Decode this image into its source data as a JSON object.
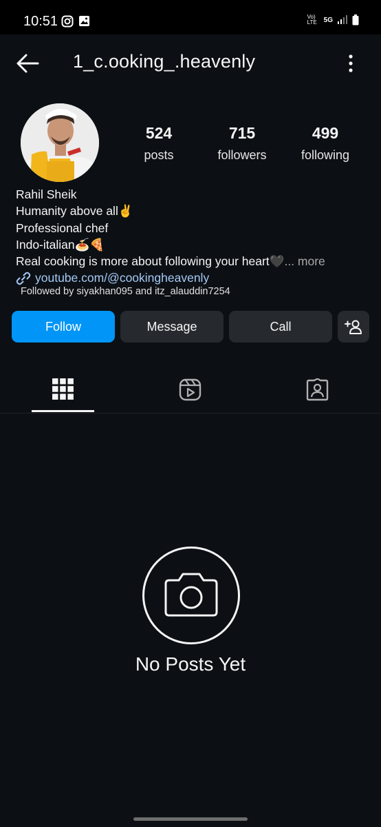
{
  "status_bar": {
    "time": "10:51",
    "network": "5G",
    "volte": "Vo) LTE"
  },
  "header": {
    "username": "1_c.ooking_.heavenly"
  },
  "stats": [
    {
      "value": "524",
      "label": "posts"
    },
    {
      "value": "715",
      "label": "followers"
    },
    {
      "value": "499",
      "label": "following"
    }
  ],
  "bio": {
    "name": "Rahil Sheik",
    "line1": "Humanity above all✌️",
    "line2": "Professional chef",
    "line3": "Indo-italian🍝🍕",
    "line4": "Real cooking is more about following your heart🖤",
    "more": "... more",
    "link": "youtube.com/@cookingheavenly",
    "followed_by": "Followed by siyakhan095 and itz_alauddin7254"
  },
  "actions": {
    "follow": "Follow",
    "message": "Message",
    "call": "Call"
  },
  "empty_state": {
    "title": "No Posts Yet"
  },
  "colors": {
    "background": "#0c1014",
    "accent": "#0095f6",
    "button": "#262a2f",
    "link": "#a5c9f5"
  }
}
